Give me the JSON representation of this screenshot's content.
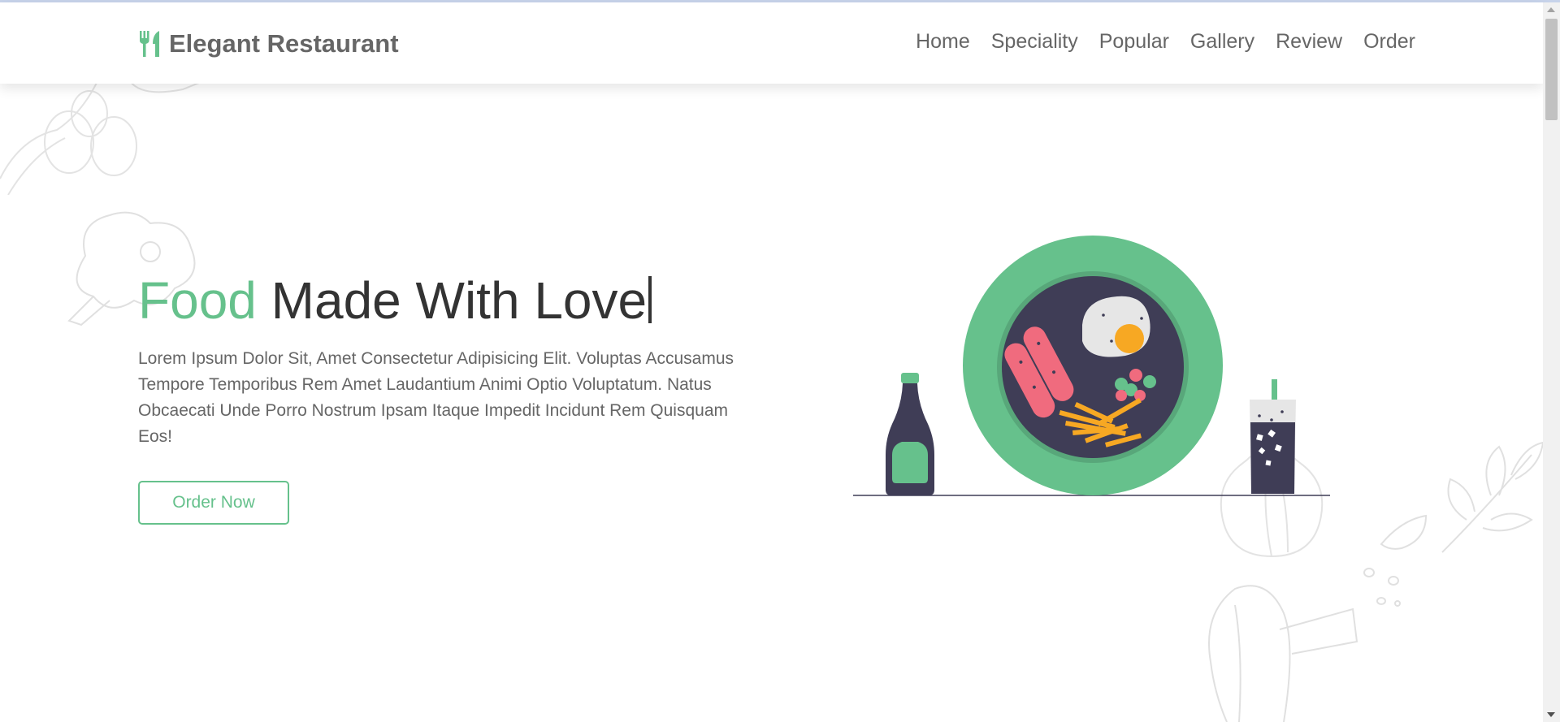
{
  "header": {
    "logo_text": "Elegant Restaurant",
    "logo_icon": "utensils-icon",
    "nav": [
      {
        "label": "Home"
      },
      {
        "label": "Speciality"
      },
      {
        "label": "Popular"
      },
      {
        "label": "Gallery"
      },
      {
        "label": "Review"
      },
      {
        "label": "Order"
      }
    ]
  },
  "hero": {
    "title_accent": "Food",
    "title_rest": "Made With Love",
    "description": "Lorem Ipsum Dolor Sit, Amet Consectetur Adipisicing Elit. Voluptas Accusamus Tempore Temporibus Rem Amet Laudantium Animi Optio Voluptatum. Natus Obcaecati Unde Porro Nostrum Ipsam Itaque Impedit Incidunt Rem Quisquam Eos!",
    "cta_label": "Order Now",
    "illustration": "food-plate-illustration"
  },
  "colors": {
    "accent": "#66c18c",
    "text_dark": "#333333",
    "text_muted": "#666666",
    "plate_inner": "#3f3d56",
    "sausage": "#f06b7e",
    "yolk": "#f7a823"
  }
}
